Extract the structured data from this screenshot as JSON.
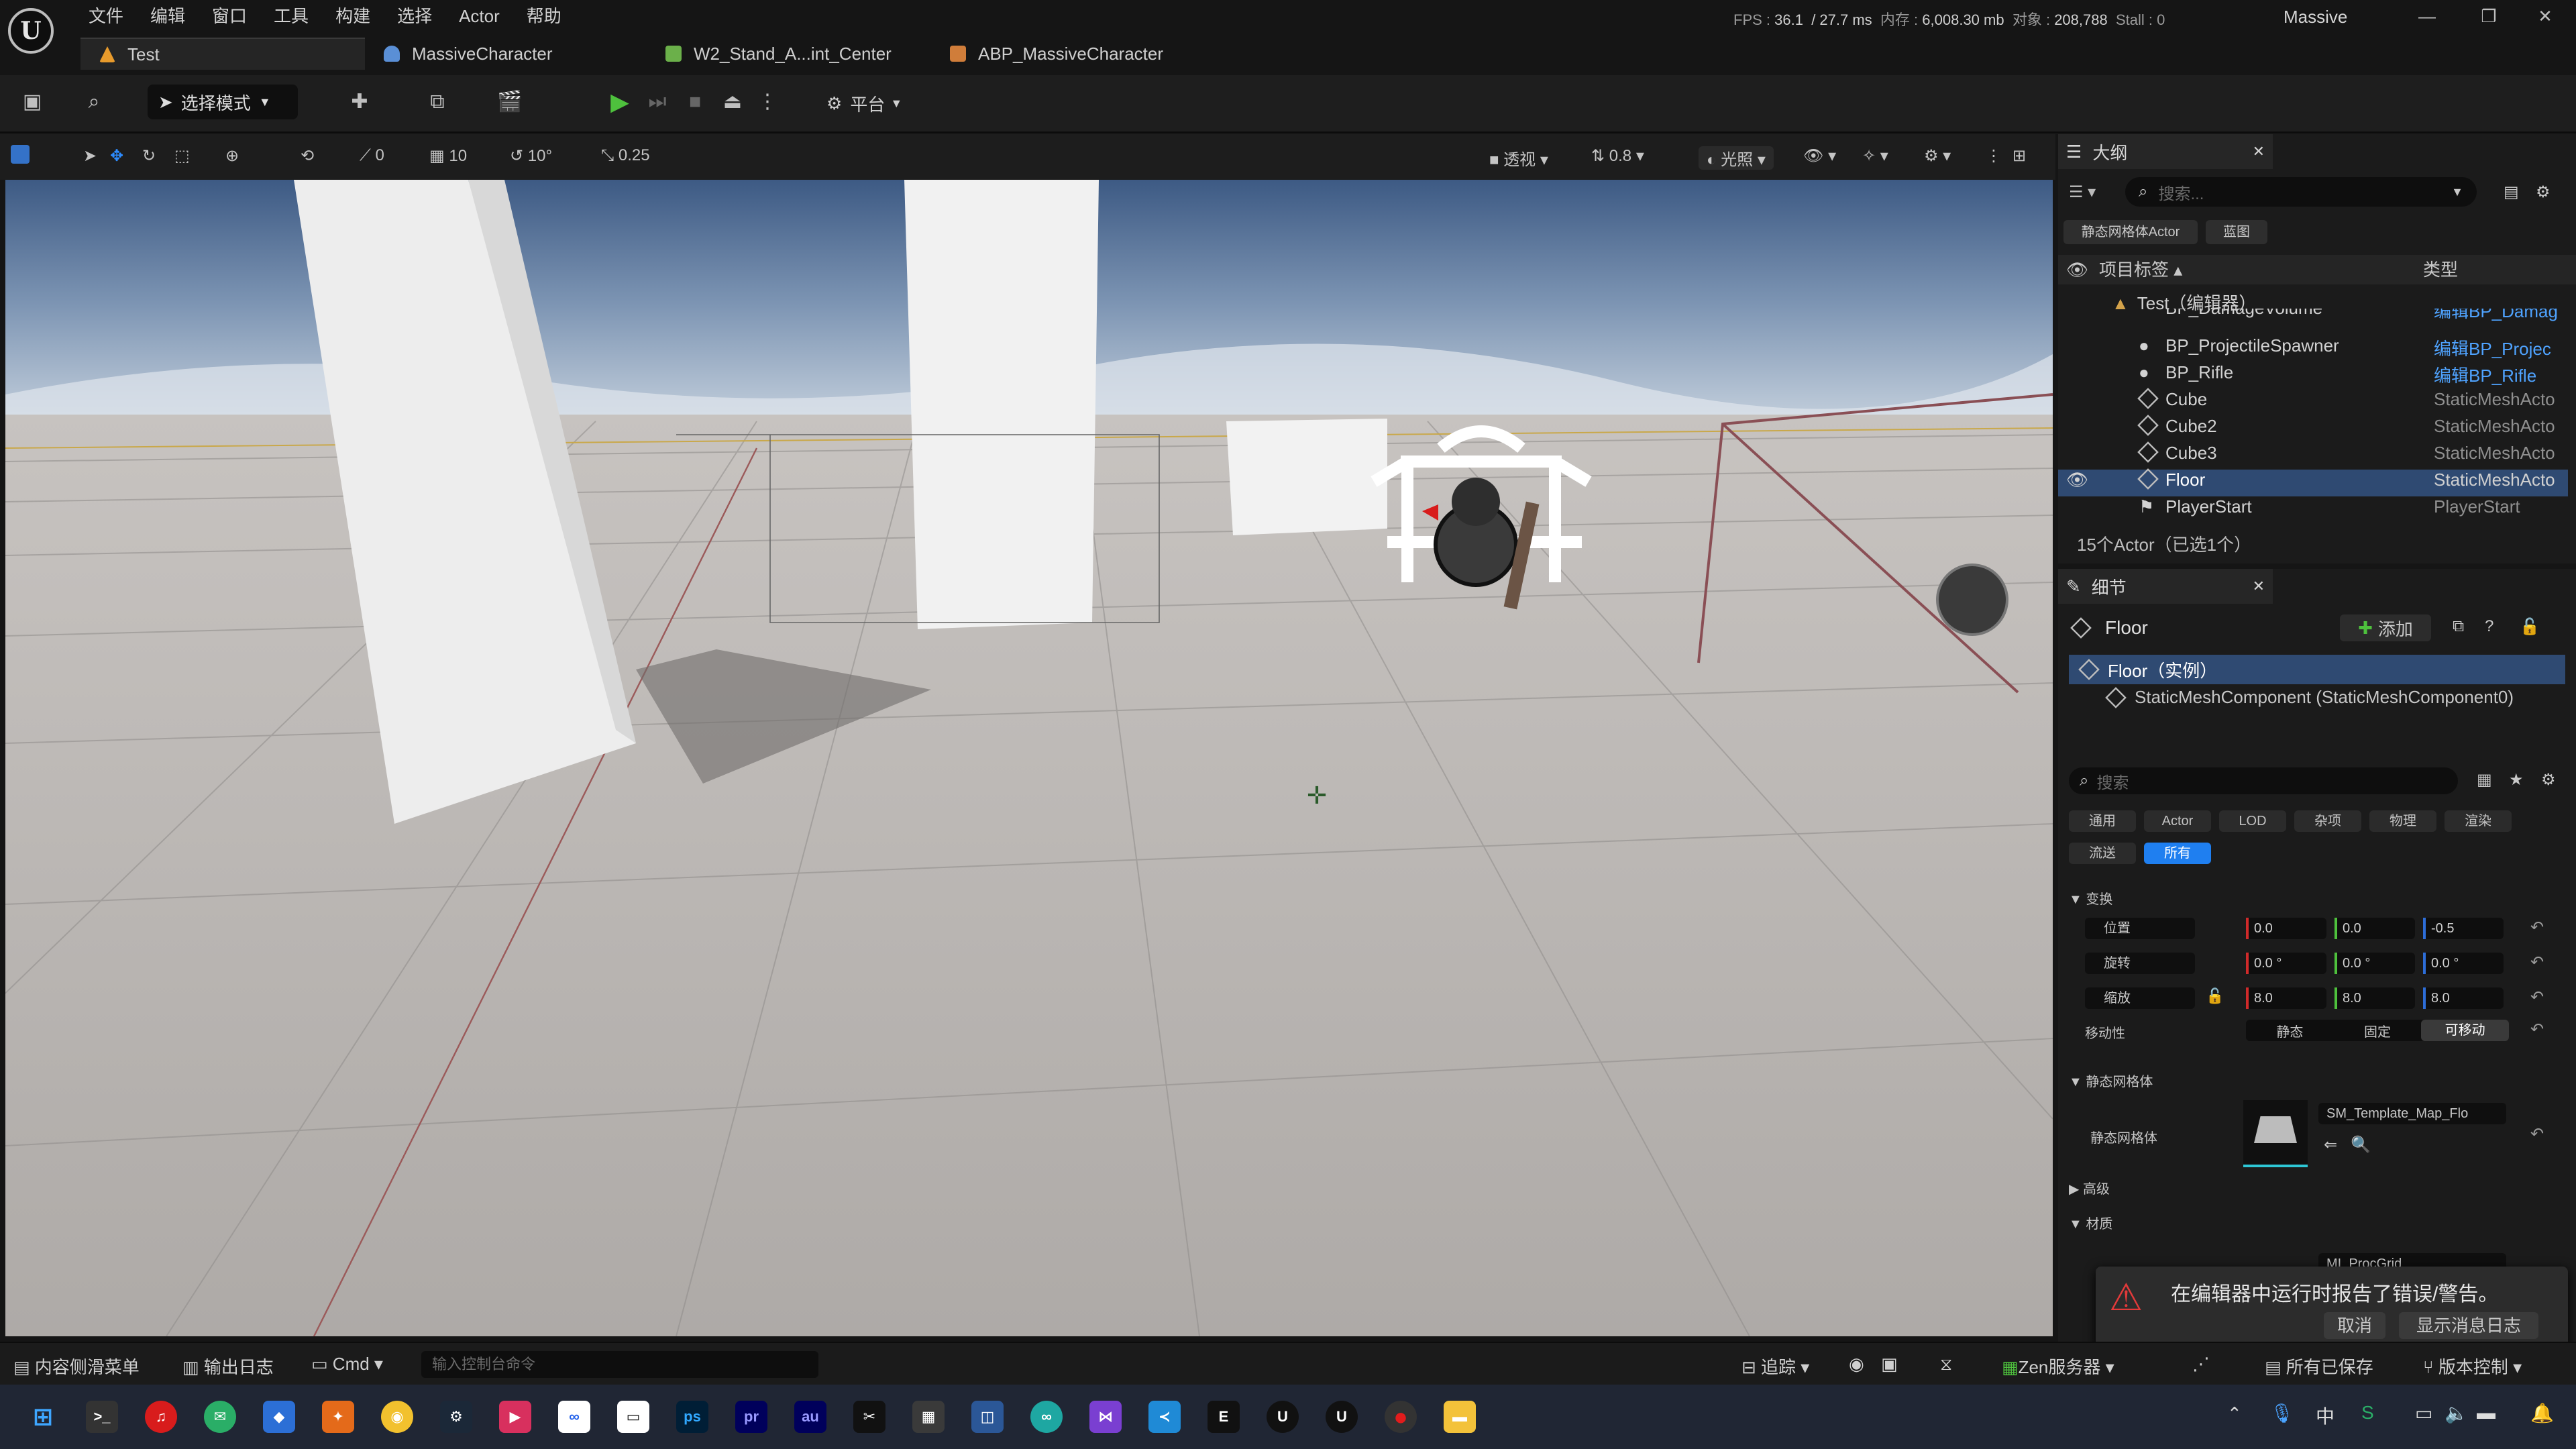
{
  "title_bar": {
    "menu": [
      "文件",
      "编辑",
      "窗口",
      "工具",
      "构建",
      "选择",
      "Actor",
      "帮助"
    ],
    "stats": {
      "fps_label": "FPS :",
      "fps": "36.1",
      "ms": "/ 27.7 ms",
      "mem_label": "内存 :",
      "mem": "6,008.30 mb",
      "obj_label": "对象 :",
      "obj": "208,788",
      "stall": "Stall : 0"
    },
    "project": "Massive",
    "window_buttons": [
      "—",
      "❐",
      "✕"
    ]
  },
  "tabs": [
    {
      "label": "Test",
      "color": "#e89b2c",
      "active": true
    },
    {
      "label": "MassiveCharacter",
      "color": "#5a8fd6",
      "active": false
    },
    {
      "label": "W2_Stand_A...int_Center",
      "color": "#6bb04a",
      "active": false
    },
    {
      "label": "ABP_MassiveCharacter",
      "color": "#d07d3a",
      "active": false
    }
  ],
  "toolbar": {
    "mode_label": "选择模式",
    "platform_label": "平台"
  },
  "viewport_toolbar": {
    "grid_snap": "10",
    "rot_snap": "10°",
    "scale_snap": "0.25",
    "angle": "0",
    "perspective": "透视",
    "cam_speed": "0.8",
    "lighting": "光照"
  },
  "outliner": {
    "tab_title": "大纲",
    "search_placeholder": "搜索...",
    "filter_chips": [
      "静态网格体Actor",
      "蓝图"
    ],
    "col_label": "项目标签 ▴",
    "col_type": "类型",
    "world": "Test（编辑器）",
    "items": [
      {
        "label": "BP_DamageVolume",
        "type": "编辑BP_Damag",
        "link": true
      },
      {
        "label": "BP_ProjectileSpawner",
        "type": "编辑BP_Projec",
        "link": true
      },
      {
        "label": "BP_Rifle",
        "type": "编辑BP_Rifle",
        "link": true
      },
      {
        "label": "Cube",
        "type": "StaticMeshActo",
        "link": false
      },
      {
        "label": "Cube2",
        "type": "StaticMeshActo",
        "link": false
      },
      {
        "label": "Cube3",
        "type": "StaticMeshActo",
        "link": false
      },
      {
        "label": "Floor",
        "type": "StaticMeshActo",
        "link": false,
        "selected": true
      },
      {
        "label": "PlayerStart",
        "type": "PlayerStart",
        "link": false
      }
    ],
    "footer": "15个Actor（已选1个）"
  },
  "details": {
    "tab_title": "细节",
    "actor_name": "Floor",
    "add_label": "添加",
    "instance": "Floor（实例）",
    "component": "StaticMeshComponent (StaticMeshComponent0)",
    "search_placeholder": "搜索",
    "filters": [
      "通用",
      "Actor",
      "LOD",
      "杂项",
      "物理",
      "渲染",
      "流送",
      "所有"
    ],
    "sections": {
      "transform": "变换",
      "static_mesh": "静态网格体",
      "advanced": "高级",
      "materials": "材质"
    },
    "location_label": "位置",
    "rotation_label": "旋转",
    "scale_label": "缩放",
    "location": [
      "0.0",
      "0.0",
      "-0.5"
    ],
    "rotation": [
      "0.0 °",
      "0.0 °",
      "0.0 °"
    ],
    "scale": [
      "8.0",
      "8.0",
      "8.0"
    ],
    "mobility_label": "移动性",
    "mobility": [
      "静态",
      "固定",
      "可移动"
    ],
    "mesh_label": "静态网格体",
    "mesh_value": "SM_Template_Map_Flo",
    "material_value": "MI_ProcGrid"
  },
  "toast": {
    "message": "在编辑器中运行时报告了错误/警告。",
    "cancel": "取消",
    "show_log": "显示消息日志"
  },
  "status_bar": {
    "content_drawer": "内容侧滑菜单",
    "output_log": "输出日志",
    "cmd": "Cmd",
    "cmd_placeholder": "输入控制台命令",
    "trace": "追踪",
    "zen": "Zen服务器",
    "saved": "所有已保存",
    "source_control": "版本控制"
  },
  "taskbar": {
    "icons": [
      "start-icon",
      "terminal-icon",
      "netease-music-icon",
      "wechat-icon",
      "app-icon",
      "butterfly-app-icon",
      "chrome-icon",
      "steam-icon",
      "app-icon",
      "meta-icon",
      "app-icon",
      "ps",
      "pr",
      "au",
      "capcut-icon",
      "calculator-icon",
      "app-icon",
      "app-icon",
      "visual-studio-icon",
      "vscode-icon",
      "epic-games-icon",
      "unreal-icon",
      "unreal-icon",
      "record-icon",
      "folder-icon"
    ],
    "tray_ime": "中"
  },
  "colors": {
    "accent": "#1f7ff0",
    "play": "#4ec13d",
    "link": "#4fa3ff",
    "error": "#e23a3a"
  }
}
